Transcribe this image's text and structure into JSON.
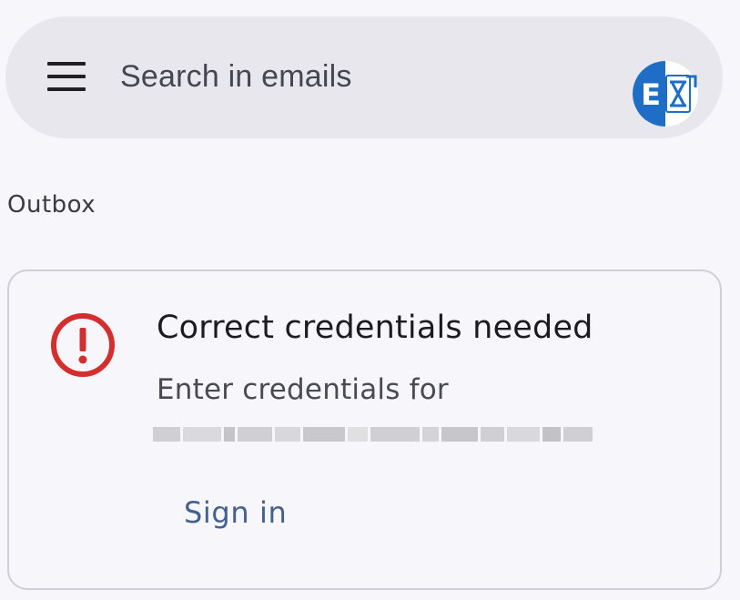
{
  "search": {
    "placeholder": "Search in emails",
    "menu_icon": "hamburger-menu-icon",
    "account_icon": "exchange-account-icon",
    "account_letter": "E"
  },
  "section": {
    "label": "Outbox"
  },
  "alert_card": {
    "icon": "error-exclamation-icon",
    "title": "Correct credentials needed",
    "body": "Enter credentials for",
    "action_label": "Sign in"
  },
  "colors": {
    "background": "#f7f6fb",
    "search_bar": "#e9e7ee",
    "error_red": "#d32f2f",
    "action_blue": "#44608f",
    "exchange_blue": "#1f6ec6"
  }
}
